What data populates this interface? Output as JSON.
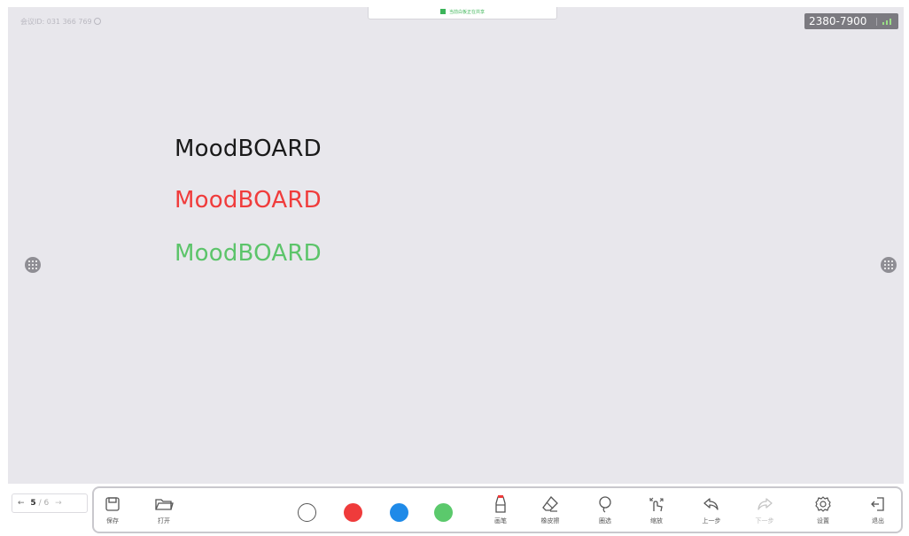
{
  "header": {
    "meeting_id": "会议ID: 031 366 769",
    "share_status": "当前白板正在共享",
    "room_code": "2380-7900"
  },
  "canvas": {
    "lines": [
      {
        "text": "MoodBOARD",
        "color": "#1a1a1a"
      },
      {
        "text": "MoodBOARD",
        "color": "#f03c3c"
      },
      {
        "text": "MoodBOARD",
        "color": "#5cc46a"
      }
    ]
  },
  "pager": {
    "prev": "←",
    "current": "5",
    "total": "/ 6",
    "next": "→"
  },
  "toolbar": {
    "save_label": "保存",
    "open_label": "打开",
    "pen_label": "画笔",
    "eraser_label": "橡皮擦",
    "lasso_label": "圈选",
    "zoom_label": "缩放",
    "undo_label": "上一步",
    "redo_label": "下一步",
    "settings_label": "设置",
    "exit_label": "退出",
    "colors": [
      "#ffffff",
      "#ef3b3b",
      "#1f8ae8",
      "#5bc96c"
    ]
  }
}
